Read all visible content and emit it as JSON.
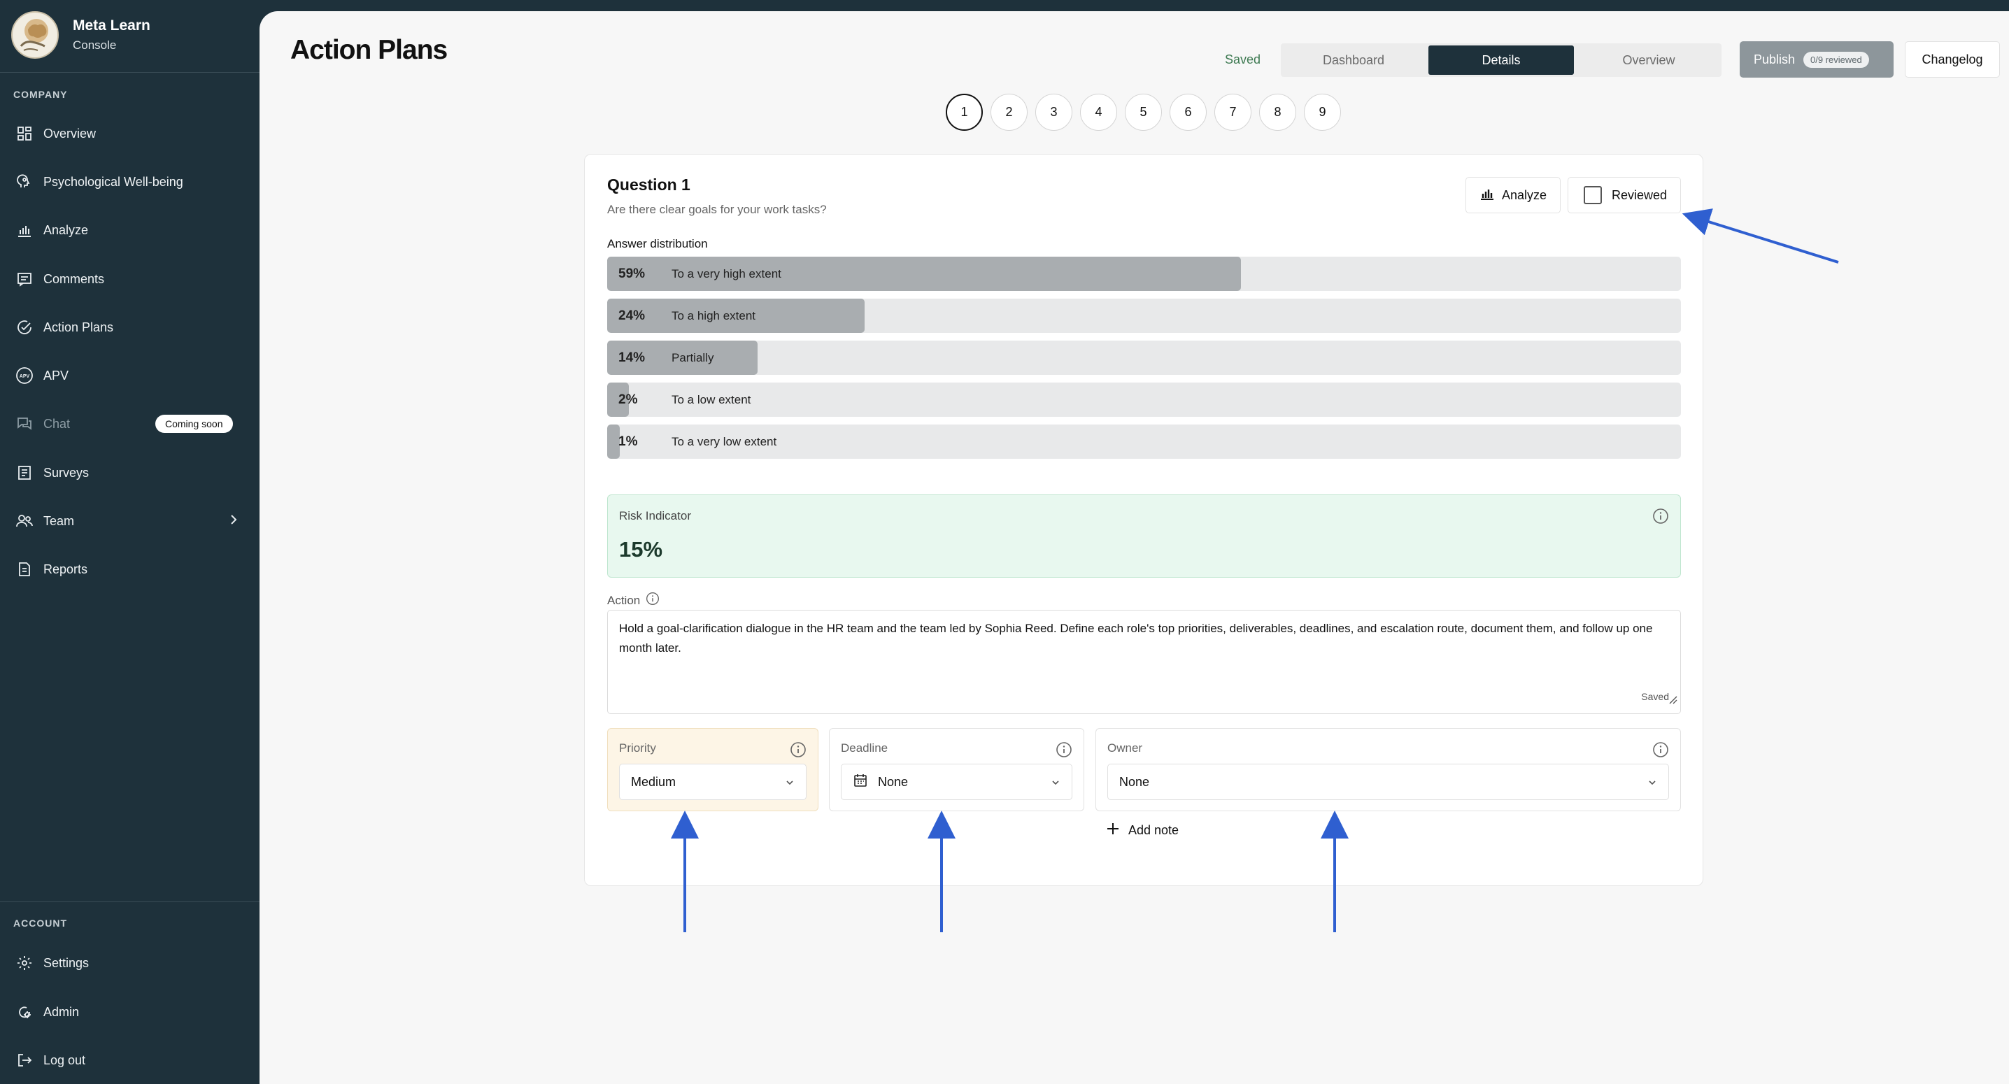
{
  "brand": {
    "name": "Meta Learn",
    "subtitle": "Console"
  },
  "sidebar": {
    "company_label": "COMPANY",
    "items": [
      {
        "label": "Overview",
        "icon": "grid-icon"
      },
      {
        "label": "Psychological Well-being",
        "icon": "head-icon"
      },
      {
        "label": "Analyze",
        "icon": "bar-chart-icon"
      },
      {
        "label": "Comments",
        "icon": "comment-icon"
      },
      {
        "label": "Action Plans",
        "icon": "check-circle-icon"
      },
      {
        "label": "APV",
        "icon": "apv-icon"
      },
      {
        "label": "Chat",
        "icon": "chat-icon",
        "badge": "Coming soon"
      },
      {
        "label": "Surveys",
        "icon": "survey-icon"
      },
      {
        "label": "Team",
        "icon": "team-icon"
      },
      {
        "label": "Reports",
        "icon": "report-icon"
      }
    ],
    "account_label": "ACCOUNT",
    "account_items": [
      {
        "label": "Settings",
        "icon": "gear-icon"
      },
      {
        "label": "Admin",
        "icon": "admin-icon"
      },
      {
        "label": "Log out",
        "icon": "logout-icon"
      }
    ]
  },
  "header": {
    "title": "Action Plans",
    "saved_status": "Saved",
    "tabs": [
      {
        "label": "Dashboard",
        "active": false
      },
      {
        "label": "Details",
        "active": true
      },
      {
        "label": "Overview",
        "active": false
      }
    ],
    "publish_label": "Publish",
    "publish_badge": "0/9 reviewed",
    "changelog_label": "Changelog"
  },
  "question_nav": [
    "1",
    "2",
    "3",
    "4",
    "5",
    "6",
    "7",
    "8",
    "9"
  ],
  "question_nav_active": 0,
  "card": {
    "title": "Question 1",
    "subtitle": "Are there clear goals for your work tasks?",
    "analyze_label": "Analyze",
    "reviewed_label": "Reviewed",
    "distribution_label": "Answer distribution",
    "distribution": [
      {
        "pct": "59%",
        "value": 59,
        "label": "To a very high extent"
      },
      {
        "pct": "24%",
        "value": 24,
        "label": "To a high extent"
      },
      {
        "pct": "14%",
        "value": 14,
        "label": "Partially"
      },
      {
        "pct": "2%",
        "value": 2,
        "label": "To a low extent"
      },
      {
        "pct": "1%",
        "value": 1,
        "label": "To a very low extent"
      }
    ],
    "risk_label": "Risk Indicator",
    "risk_value": "15%",
    "action_label": "Action",
    "action_text": "Hold a goal-clarification dialogue in the HR team and the team led by Sophia Reed. Define each role's top priorities, deliverables, deadlines, and escalation route, document them, and follow up one month later.",
    "action_saved": "Saved",
    "priority_label": "Priority",
    "priority_value": "Medium",
    "deadline_label": "Deadline",
    "deadline_value": "None",
    "owner_label": "Owner",
    "owner_value": "None",
    "add_note_label": "Add note"
  },
  "colors": {
    "sidebar_bg": "#1e313b",
    "accent_dark": "#1e313b",
    "risk_bg": "#e8f8ef",
    "priority_bg": "#fdf5e6",
    "annotation_arrow": "#2f5fd0"
  }
}
